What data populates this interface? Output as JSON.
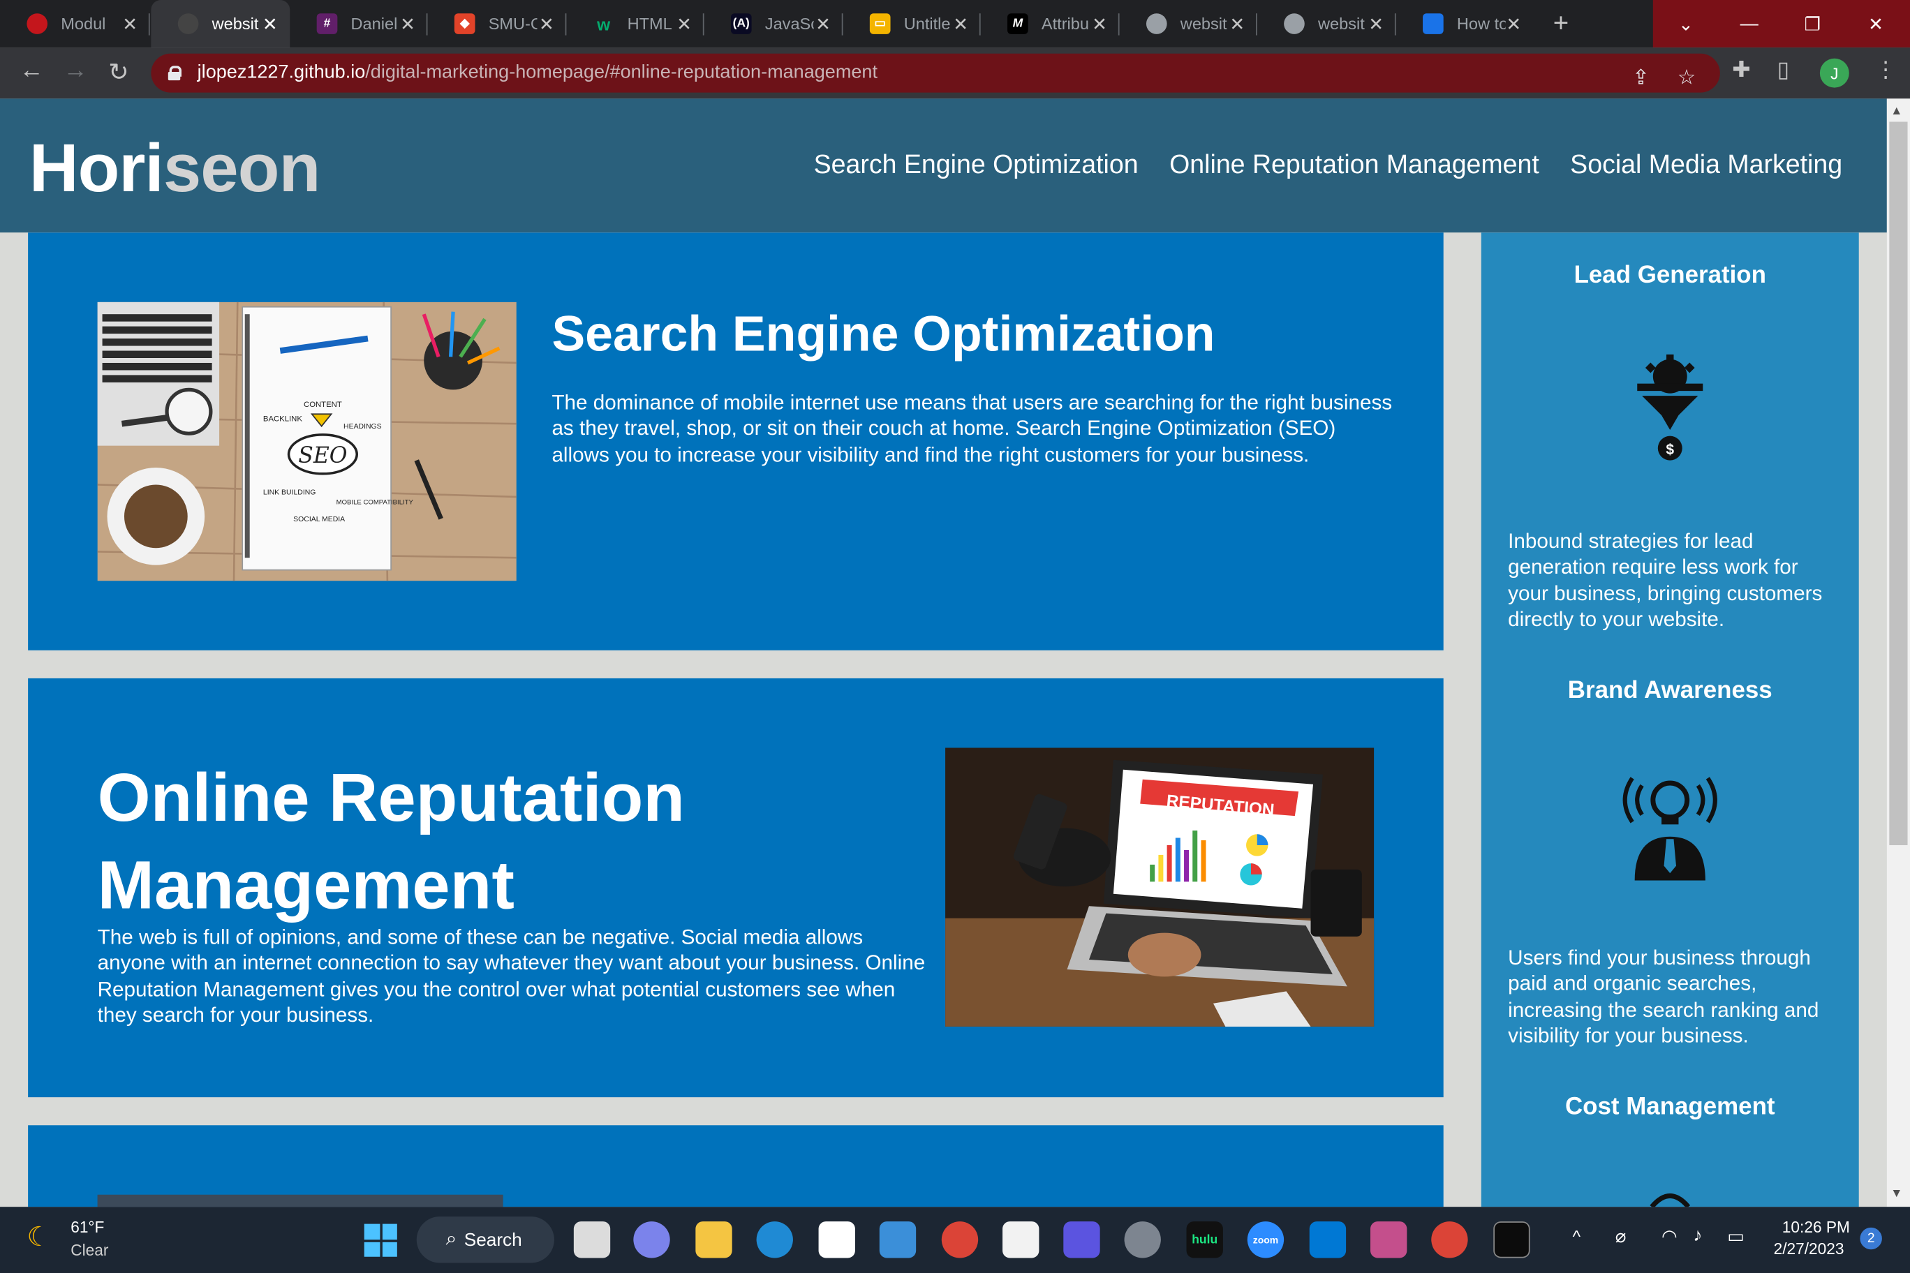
{
  "browser": {
    "tabs": [
      {
        "label": "Modul",
        "icon": "red-circle-icon",
        "color": "#c4161c",
        "active": false
      },
      {
        "label": "websit",
        "icon": "github-icon",
        "color": "#444444",
        "active": true
      },
      {
        "label": "Daniel",
        "icon": "slack-icon",
        "color": "#611f69",
        "active": false
      },
      {
        "label": "SMU-C",
        "icon": "gitlab-icon",
        "color": "#e24329",
        "active": false
      },
      {
        "label": "HTML",
        "icon": "w3schools-icon",
        "color": "#04aa6d",
        "active": false
      },
      {
        "label": "JavaSc",
        "icon": "freecodecamp-icon",
        "color": "#0a0a23",
        "active": false
      },
      {
        "label": "Untitle",
        "icon": "google-slides-icon",
        "color": "#f4b400",
        "active": false
      },
      {
        "label": "Attribu",
        "icon": "mdn-icon",
        "color": "#000000",
        "active": false
      },
      {
        "label": "websit",
        "icon": "globe-icon",
        "color": "#5f6368",
        "active": false
      },
      {
        "label": "websit",
        "icon": "globe-icon",
        "color": "#5f6368",
        "active": false
      },
      {
        "label": "How to",
        "icon": "blue-square-icon",
        "color": "#1a73e8",
        "active": false
      }
    ],
    "url_host": "jlopez1227.github.io",
    "url_path": "/digital-marketing-homepage/#online-reputation-management",
    "profile_initial": "J"
  },
  "header": {
    "logo_main": "Hori",
    "logo_accent": "seon",
    "nav": [
      "Search Engine Optimization",
      "Online Reputation Management",
      "Social Media Marketing"
    ]
  },
  "sections": [
    {
      "title": "Search Engine Optimization",
      "text": "The dominance of mobile internet use means that users are searching for the right business as they travel, shop, or sit on their couch at home. Search Engine Optimization (SEO) allows you to increase your visibility and find the right customers for your business.",
      "image_labels": [
        "CONTENT",
        "BACKLINK",
        "HEADINGS",
        "SEO",
        "LINK BUILDING",
        "MOBILE COMPATIBILITY",
        "SOCIAL MEDIA"
      ]
    },
    {
      "title": "Online Reputation Management",
      "text": "The web is full of opinions, and some of these can be negative. Social media allows anyone with an internet connection to say whatever they want about your business. Online Reputation Management gives you the control over what potential customers see when they search for your business.",
      "image_label": "REPUTATION"
    }
  ],
  "benefits": [
    {
      "title": "Lead Generation",
      "icon": "lead-generation-icon",
      "text": "Inbound strategies for lead generation require less work for your business, bringing customers directly to your website."
    },
    {
      "title": "Brand Awareness",
      "icon": "brand-awareness-icon",
      "text": "Users find your business through paid and organic searches, increasing the search ranking and visibility for your business."
    },
    {
      "title": "Cost Management",
      "icon": "cost-management-icon",
      "text": ""
    }
  ],
  "taskbar": {
    "weather_temp": "61°F",
    "weather_desc": "Clear",
    "search_label": "Search",
    "time": "10:26 PM",
    "date": "2/27/2023",
    "notification_count": "2",
    "apps": [
      "hulu",
      "zoom"
    ]
  },
  "colors": {
    "header_bg": "#2a607c",
    "card_bg": "#0072bb",
    "aside_bg": "#2589bd",
    "page_bg": "#d9dad7"
  }
}
